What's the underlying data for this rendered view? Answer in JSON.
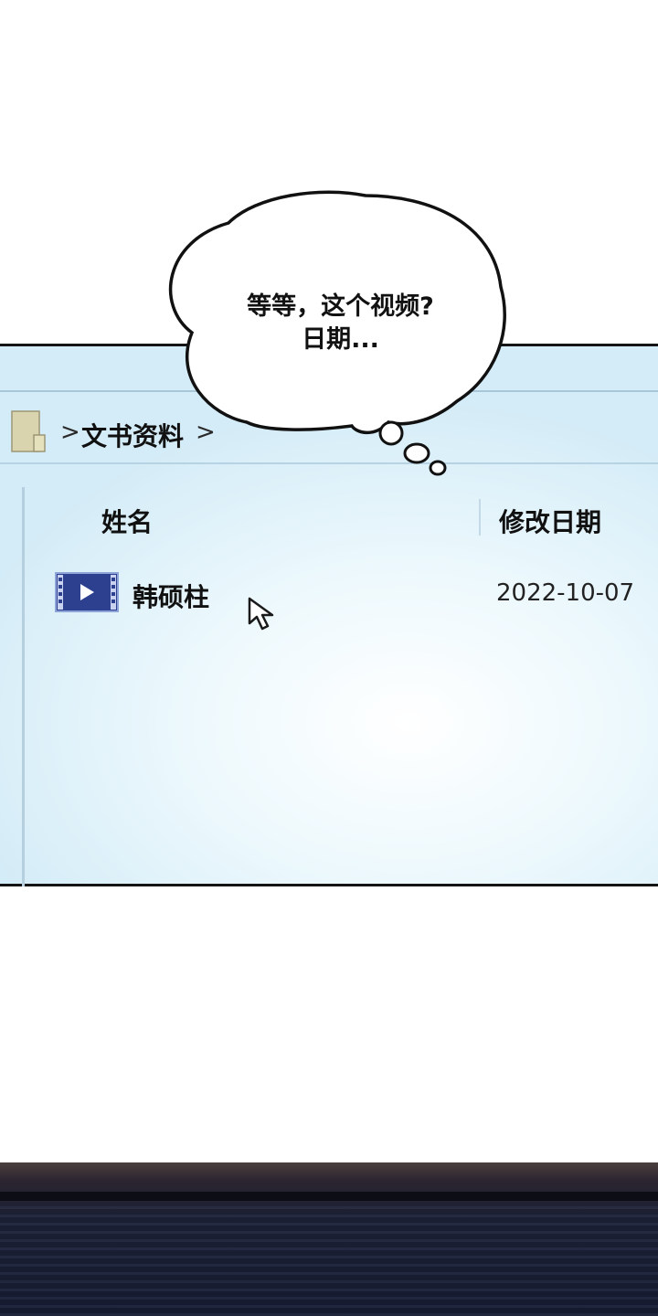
{
  "speech_bubble": {
    "line1": "等等，这个视频?",
    "line2": "日期..."
  },
  "explorer": {
    "breadcrumb": {
      "folder_icon": "folder-icon",
      "separator": ">",
      "path": "文书资料"
    },
    "columns": {
      "name": "姓名",
      "modified_date": "修改日期"
    },
    "files": [
      {
        "icon": "video-file-icon",
        "name": "韩硕柱",
        "modified_date": "2022-10-07"
      }
    ],
    "cursor_icon": "mouse-pointer-icon"
  },
  "colors": {
    "panel_border": "#141414",
    "panel_background": "#dff2fa",
    "video_icon_blue": "#2d3f8f",
    "bottom_band": "#1b1f33"
  }
}
